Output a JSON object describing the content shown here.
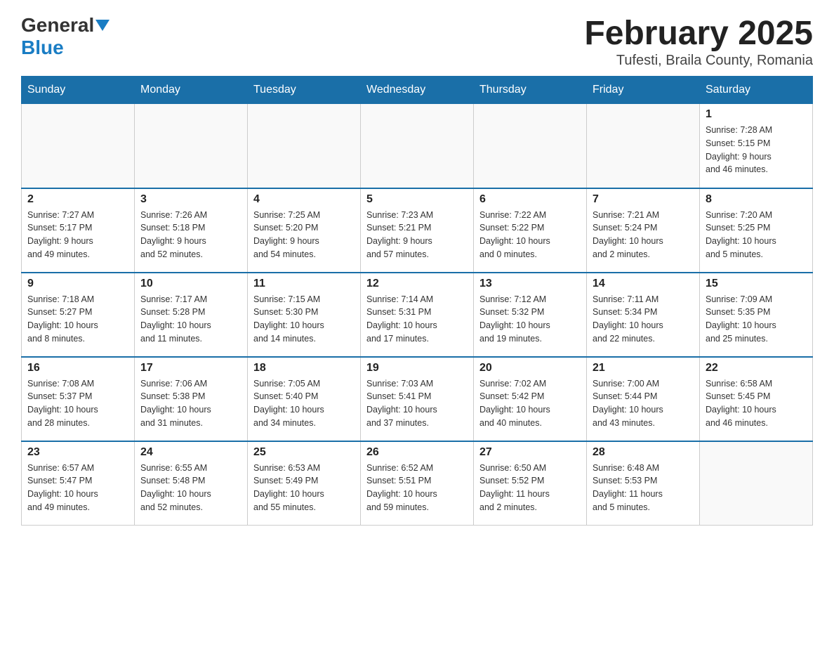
{
  "header": {
    "logo_general": "General",
    "logo_blue": "Blue",
    "month_title": "February 2025",
    "location": "Tufesti, Braila County, Romania"
  },
  "weekdays": [
    "Sunday",
    "Monday",
    "Tuesday",
    "Wednesday",
    "Thursday",
    "Friday",
    "Saturday"
  ],
  "weeks": [
    [
      {
        "day": "",
        "info": ""
      },
      {
        "day": "",
        "info": ""
      },
      {
        "day": "",
        "info": ""
      },
      {
        "day": "",
        "info": ""
      },
      {
        "day": "",
        "info": ""
      },
      {
        "day": "",
        "info": ""
      },
      {
        "day": "1",
        "info": "Sunrise: 7:28 AM\nSunset: 5:15 PM\nDaylight: 9 hours\nand 46 minutes."
      }
    ],
    [
      {
        "day": "2",
        "info": "Sunrise: 7:27 AM\nSunset: 5:17 PM\nDaylight: 9 hours\nand 49 minutes."
      },
      {
        "day": "3",
        "info": "Sunrise: 7:26 AM\nSunset: 5:18 PM\nDaylight: 9 hours\nand 52 minutes."
      },
      {
        "day": "4",
        "info": "Sunrise: 7:25 AM\nSunset: 5:20 PM\nDaylight: 9 hours\nand 54 minutes."
      },
      {
        "day": "5",
        "info": "Sunrise: 7:23 AM\nSunset: 5:21 PM\nDaylight: 9 hours\nand 57 minutes."
      },
      {
        "day": "6",
        "info": "Sunrise: 7:22 AM\nSunset: 5:22 PM\nDaylight: 10 hours\nand 0 minutes."
      },
      {
        "day": "7",
        "info": "Sunrise: 7:21 AM\nSunset: 5:24 PM\nDaylight: 10 hours\nand 2 minutes."
      },
      {
        "day": "8",
        "info": "Sunrise: 7:20 AM\nSunset: 5:25 PM\nDaylight: 10 hours\nand 5 minutes."
      }
    ],
    [
      {
        "day": "9",
        "info": "Sunrise: 7:18 AM\nSunset: 5:27 PM\nDaylight: 10 hours\nand 8 minutes."
      },
      {
        "day": "10",
        "info": "Sunrise: 7:17 AM\nSunset: 5:28 PM\nDaylight: 10 hours\nand 11 minutes."
      },
      {
        "day": "11",
        "info": "Sunrise: 7:15 AM\nSunset: 5:30 PM\nDaylight: 10 hours\nand 14 minutes."
      },
      {
        "day": "12",
        "info": "Sunrise: 7:14 AM\nSunset: 5:31 PM\nDaylight: 10 hours\nand 17 minutes."
      },
      {
        "day": "13",
        "info": "Sunrise: 7:12 AM\nSunset: 5:32 PM\nDaylight: 10 hours\nand 19 minutes."
      },
      {
        "day": "14",
        "info": "Sunrise: 7:11 AM\nSunset: 5:34 PM\nDaylight: 10 hours\nand 22 minutes."
      },
      {
        "day": "15",
        "info": "Sunrise: 7:09 AM\nSunset: 5:35 PM\nDaylight: 10 hours\nand 25 minutes."
      }
    ],
    [
      {
        "day": "16",
        "info": "Sunrise: 7:08 AM\nSunset: 5:37 PM\nDaylight: 10 hours\nand 28 minutes."
      },
      {
        "day": "17",
        "info": "Sunrise: 7:06 AM\nSunset: 5:38 PM\nDaylight: 10 hours\nand 31 minutes."
      },
      {
        "day": "18",
        "info": "Sunrise: 7:05 AM\nSunset: 5:40 PM\nDaylight: 10 hours\nand 34 minutes."
      },
      {
        "day": "19",
        "info": "Sunrise: 7:03 AM\nSunset: 5:41 PM\nDaylight: 10 hours\nand 37 minutes."
      },
      {
        "day": "20",
        "info": "Sunrise: 7:02 AM\nSunset: 5:42 PM\nDaylight: 10 hours\nand 40 minutes."
      },
      {
        "day": "21",
        "info": "Sunrise: 7:00 AM\nSunset: 5:44 PM\nDaylight: 10 hours\nand 43 minutes."
      },
      {
        "day": "22",
        "info": "Sunrise: 6:58 AM\nSunset: 5:45 PM\nDaylight: 10 hours\nand 46 minutes."
      }
    ],
    [
      {
        "day": "23",
        "info": "Sunrise: 6:57 AM\nSunset: 5:47 PM\nDaylight: 10 hours\nand 49 minutes."
      },
      {
        "day": "24",
        "info": "Sunrise: 6:55 AM\nSunset: 5:48 PM\nDaylight: 10 hours\nand 52 minutes."
      },
      {
        "day": "25",
        "info": "Sunrise: 6:53 AM\nSunset: 5:49 PM\nDaylight: 10 hours\nand 55 minutes."
      },
      {
        "day": "26",
        "info": "Sunrise: 6:52 AM\nSunset: 5:51 PM\nDaylight: 10 hours\nand 59 minutes."
      },
      {
        "day": "27",
        "info": "Sunrise: 6:50 AM\nSunset: 5:52 PM\nDaylight: 11 hours\nand 2 minutes."
      },
      {
        "day": "28",
        "info": "Sunrise: 6:48 AM\nSunset: 5:53 PM\nDaylight: 11 hours\nand 5 minutes."
      },
      {
        "day": "",
        "info": ""
      }
    ]
  ]
}
